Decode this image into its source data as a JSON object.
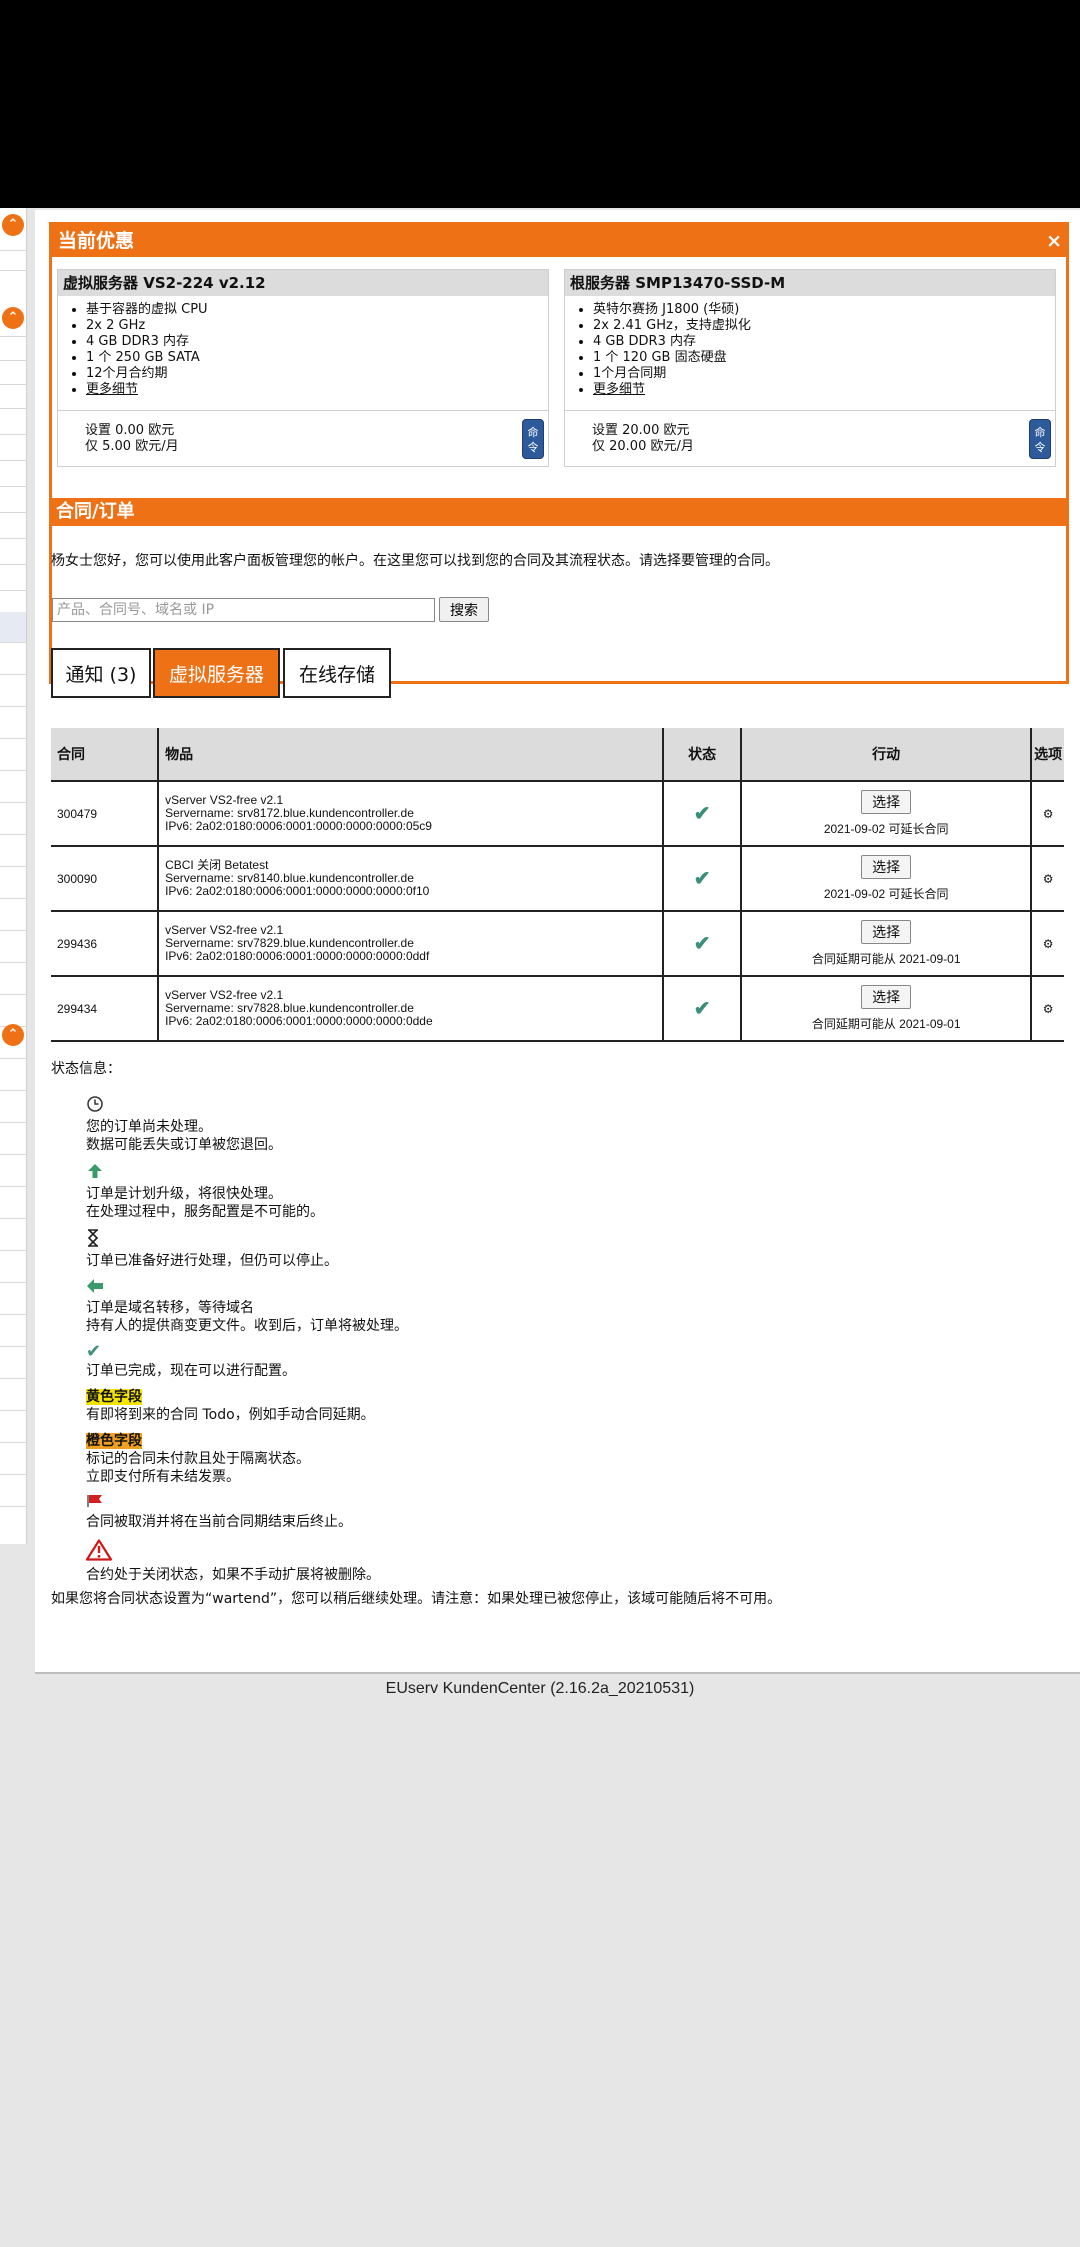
{
  "offers": {
    "title": "当前优惠",
    "close": "×",
    "cards": [
      {
        "title": "虚拟服务器 VS2-224 v2.12",
        "features": [
          "基于容器的虚拟 CPU",
          "2x 2 GHz",
          "4 GB DDR3 内存",
          "1 个 250 GB SATA",
          "12个月合约期"
        ],
        "more": "更多细节",
        "setup": "设置 0.00 欧元",
        "monthly": "仅 5.00 欧元/月",
        "order": "命令"
      },
      {
        "title": "根服务器 SMP13470-SSD-M",
        "features": [
          "英特尔赛扬 J1800 (华硕)",
          "2x 2.41 GHz，支持虚拟化",
          "4 GB DDR3 内存",
          "1 个 120 GB 固态硬盘",
          "1个月合同期"
        ],
        "more": "更多细节",
        "setup": "设置 20.00 欧元",
        "monthly": "仅 20.00 欧元/月",
        "order": "命令"
      }
    ]
  },
  "contracts": {
    "title": "合同/订单",
    "intro": "杨女士您好，您可以使用此客户面板管理您的帐户。在这里您可以找到您的合同及其流程状态。请选择要管理的合同。",
    "search_placeholder": "产品、合同号、域名或 IP",
    "search_button": "搜索",
    "tabs": [
      "通知 (3)",
      "虚拟服务器",
      "在线存储"
    ],
    "columns": [
      "合同",
      "物品",
      "状态",
      "行动",
      "选项"
    ],
    "rows": [
      {
        "id": "300479",
        "item_line1": "vServer VS2-free v2.1",
        "item_line2": "Servername: srv8172.blue.kundencontroller.de",
        "item_line3": "IPv6: 2a02:0180:0006:0001:0000:0000:0000:05c9",
        "action": "选择",
        "note": "2021-09-02 可延长合同"
      },
      {
        "id": "300090",
        "item_line1": "CBCI 关闭 Betatest",
        "item_line2": "Servername: srv8140.blue.kundencontroller.de",
        "item_line3": "IPv6: 2a02:0180:0006:0001:0000:0000:0000:0f10",
        "action": "选择",
        "note": "2021-09-02 可延长合同"
      },
      {
        "id": "299436",
        "item_line1": "vServer VS2-free v2.1",
        "item_line2": "Servername: srv7829.blue.kundencontroller.de",
        "item_line3": "IPv6: 2a02:0180:0006:0001:0000:0000:0000:0ddf",
        "action": "选择",
        "note": "合同延期可能从 2021-09-01"
      },
      {
        "id": "299434",
        "item_line1": "vServer VS2-free v2.1",
        "item_line2": "Servername: srv7828.blue.kundencontroller.de",
        "item_line3": "IPv6: 2a02:0180:0006:0001:0000:0000:0000:0dde",
        "action": "选择",
        "note": "合同延期可能从 2021-09-01"
      }
    ]
  },
  "status_info": {
    "title": "状态信息：",
    "items": {
      "pending": [
        "您的订单尚未处理。",
        "数据可能丢失或订单被您退回。"
      ],
      "upgrade": [
        "订单是计划升级，将很快处理。",
        "在处理过程中，服务配置是不可能的。"
      ],
      "ready": [
        "订单已准备好进行处理，但仍可以停止。"
      ],
      "transfer": [
        "订单是域名转移，等待域名",
        "持有人的提供商变更文件。收到后，订单将被处理。"
      ],
      "done": [
        "订单已完成，现在可以进行配置。"
      ],
      "yellow_label": "黄色字段",
      "yellow_desc": "有即将到来的合同 Todo，例如手动合同延期。",
      "orange_label": "橙色字段",
      "orange_desc": [
        "标记的合同未付款且处于隔离状态。",
        "立即支付所有未结发票。"
      ],
      "cancelled": "合同被取消并将在当前合同期结束后终止。",
      "closed": "合约处于关闭状态，如果不手动扩展将被删除。"
    },
    "final_note": "如果您将合同状态设置为“wartend”，您可以稍后继续处理。请注意：如果处理已被您停止，该域可能随后将不可用。"
  },
  "footer": "EUserv KundenCenter (2.16.2a_20210531)",
  "icons": {
    "rail_toggle": "chevron-up-circle-icon",
    "check": "checkmark-icon",
    "gear": "gear-icon",
    "clock": "clock-icon",
    "arrow_up": "arrow-up-icon",
    "hourglass": "hourglass-icon",
    "arrow_left": "arrow-left-icon",
    "flag": "flag-icon",
    "warning": "warning-icon"
  },
  "colors": {
    "accent": "#ef7116",
    "check": "#3b8f7a",
    "command": "#2c5a9a",
    "yellow": "#f4e400",
    "orange": "#f0a020"
  }
}
